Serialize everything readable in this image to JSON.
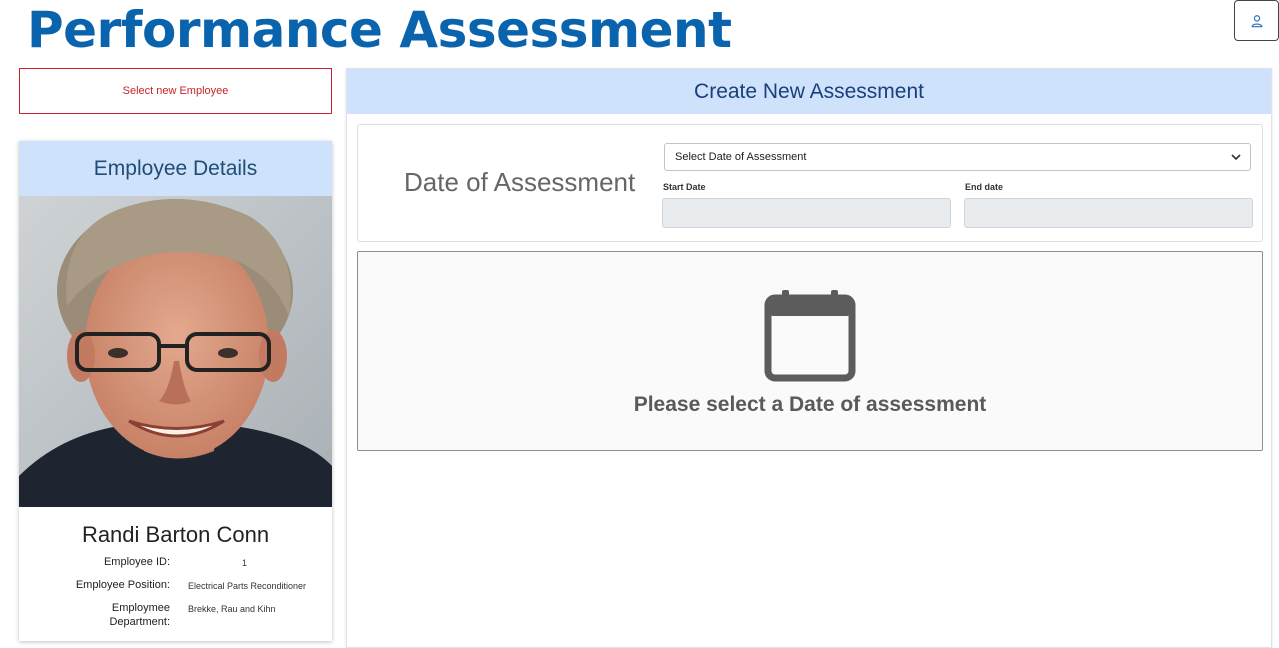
{
  "header": {
    "title": "Performance Assessment",
    "user_icon": "user-icon"
  },
  "sidebar": {
    "select_employee_label": "Select new Employee",
    "card_title": "Employee Details",
    "employee": {
      "name": "Randi Barton Conn",
      "id_label": "Employee ID:",
      "id_value": "1",
      "position_label": "Employee Position:",
      "position_value": "Electrical Parts Reconditioner",
      "department_label": "Employmee Department:",
      "department_value": "Brekke, Rau and Kihn"
    }
  },
  "main": {
    "panel_title": "Create New Assessment",
    "date_of_assessment_label": "Date of Assessment",
    "date_select_placeholder": "Select Date of Assessment",
    "start_date_label": "Start Date",
    "end_date_label": "End date",
    "empty_state_icon": "calendar-icon",
    "empty_state_text": "Please select a Date of assessment"
  },
  "colors": {
    "brand_blue": "#0a63ad",
    "header_bg": "#cfe2fb",
    "danger_red": "#c8232c"
  }
}
